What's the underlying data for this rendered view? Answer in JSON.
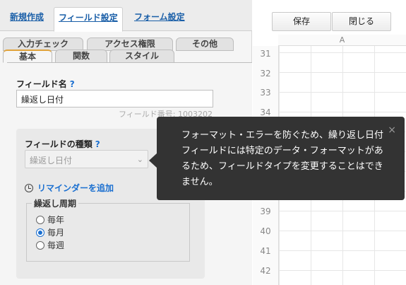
{
  "top_tabs": [
    {
      "label": "新規作成"
    },
    {
      "label": "フィールド設定"
    },
    {
      "label": "フォーム設定"
    }
  ],
  "sub_tabs_row1": [
    {
      "label": "入力チェック"
    },
    {
      "label": "アクセス権限"
    },
    {
      "label": "その他"
    }
  ],
  "sub_tabs_row2": [
    {
      "label": "基本"
    },
    {
      "label": "関数"
    },
    {
      "label": "スタイル"
    }
  ],
  "field_name": {
    "label": "フィールド名",
    "help": "?",
    "value": "繰返し日付",
    "field_number": "フィールド番号: 1003202"
  },
  "field_type": {
    "label": "フィールドの種類",
    "help": "?",
    "selected": "繰返し日付"
  },
  "reminder": {
    "label": "リマインダーを追加",
    "icon": "clock-icon"
  },
  "repeat": {
    "legend": "繰返し周期",
    "options": [
      {
        "label": "毎年",
        "checked": false
      },
      {
        "label": "毎月",
        "checked": true
      },
      {
        "label": "毎週",
        "checked": false
      }
    ]
  },
  "buttons": {
    "save": "保存",
    "close": "閉じる"
  },
  "sheet": {
    "column": "A",
    "rows": [
      "31",
      "32",
      "33",
      "34",
      "39",
      "40",
      "41",
      "42"
    ]
  },
  "tooltip": {
    "text": "フォーマット・エラーを防ぐため、繰り返し日付フィールドには特定のデータ・フォーマットがあるため、フィールドタイプを変更することはできません。",
    "close": "×"
  }
}
